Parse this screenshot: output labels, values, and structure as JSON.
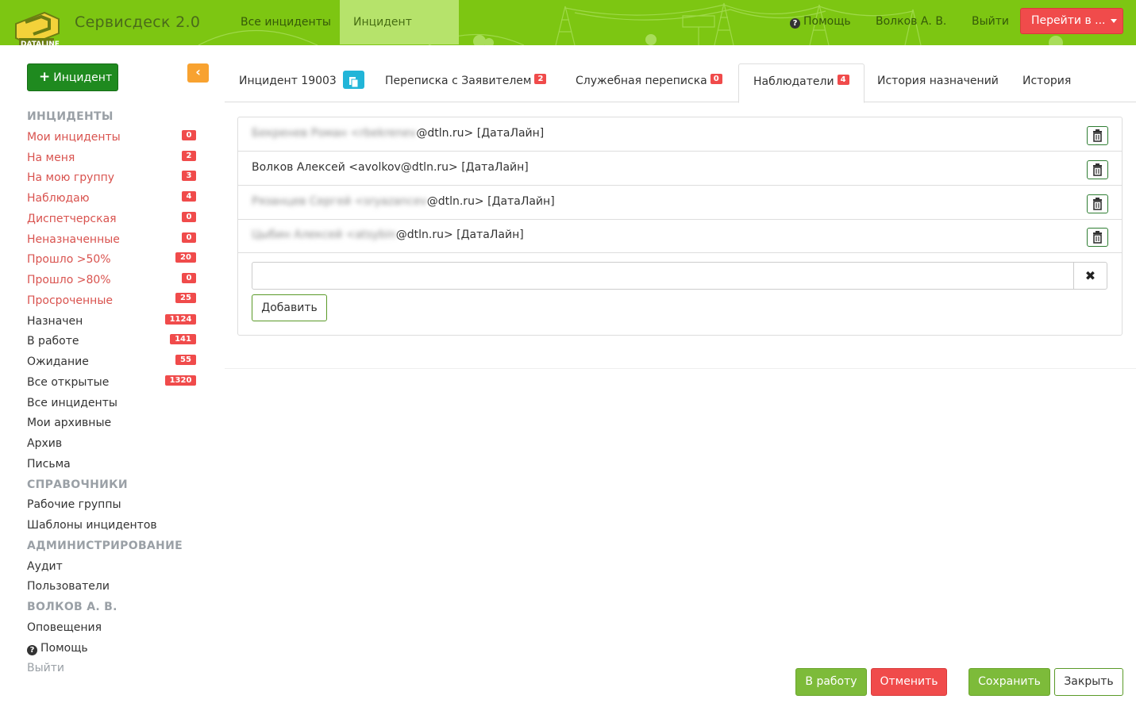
{
  "navbar": {
    "logo_text": "DATALINE",
    "brand": "Сервисдеск 2.0",
    "links": [
      "Все инциденты",
      "Инцидент 19003"
    ],
    "help": "Помощь",
    "user": "Волков А. В.",
    "exit": "Выйти",
    "goto": "Перейти в ..."
  },
  "sidebar": {
    "new_incident": "Инцидент",
    "sections": {
      "incidents": "ИНЦИДЕНТЫ",
      "directories": "СПРАВОЧНИКИ",
      "admin": "АДМИНИСТРИРОВАНИЕ",
      "user": "ВОЛКОВ А. В."
    },
    "incident_items": [
      {
        "label": "Мои инциденты",
        "count": "0"
      },
      {
        "label": "На меня",
        "count": "2"
      },
      {
        "label": "На мою группу",
        "count": "3"
      },
      {
        "label": "Наблюдаю",
        "count": "4"
      },
      {
        "label": "Диспетчерская",
        "count": "0"
      },
      {
        "label": "Неназначенные",
        "count": "0"
      },
      {
        "label": "Прошло >50%",
        "count": "20"
      },
      {
        "label": "Прошло >80%",
        "count": "0"
      },
      {
        "label": "Просроченные",
        "count": "25"
      },
      {
        "label": "Назначен",
        "count": "1124"
      },
      {
        "label": "В работе",
        "count": "141"
      },
      {
        "label": "Ожидание",
        "count": "55"
      },
      {
        "label": "Все открытые",
        "count": "1320"
      },
      {
        "label": "Все инциденты"
      },
      {
        "label": "Мои архивные"
      },
      {
        "label": "Архив"
      },
      {
        "label": "Письма"
      }
    ],
    "directory_items": [
      "Рабочие группы",
      "Шаблоны инцидентов"
    ],
    "admin_items": [
      "Аудит",
      "Пользователи"
    ],
    "user_items": [
      "Оповещения",
      "Помощь",
      "Выйти"
    ]
  },
  "tabs": [
    {
      "label": "Инцидент 19003"
    },
    {
      "label": "Переписка с Заявителем",
      "badge": "2"
    },
    {
      "label": "Служебная переписка",
      "badge": "0"
    },
    {
      "label": "Наблюдатели",
      "badge": "4"
    },
    {
      "label": "История назначений"
    },
    {
      "label": "История"
    }
  ],
  "watchers": [
    {
      "hidden": "Бекренев Роман <rbekrenev",
      "visible": "@dtln.ru> [ДатаЛайн]"
    },
    {
      "hidden": "",
      "visible": "Волков Алексей <avolkov@dtln.ru> [ДатаЛайн]"
    },
    {
      "hidden": "Рязанцев Сергей <sryazancev",
      "visible": "@dtln.ru> [ДатаЛайн]"
    },
    {
      "hidden": "Цыбин Алексей <atsybin",
      "visible": "@dtln.ru> [ДатаЛайн]"
    }
  ],
  "add_form": {
    "value": "",
    "clear_glyph": "✖",
    "add_label": "Добавить"
  },
  "footer": {
    "to_work": "В работу",
    "cancel": "Отменить",
    "save": "Сохранить",
    "close": "Закрыть"
  },
  "colors": {
    "navbar": "#7dc612",
    "danger": "#f04b4b",
    "primary_green": "#1f8a1f",
    "accent_orange": "#f8a230",
    "info": "#22b5d8"
  }
}
